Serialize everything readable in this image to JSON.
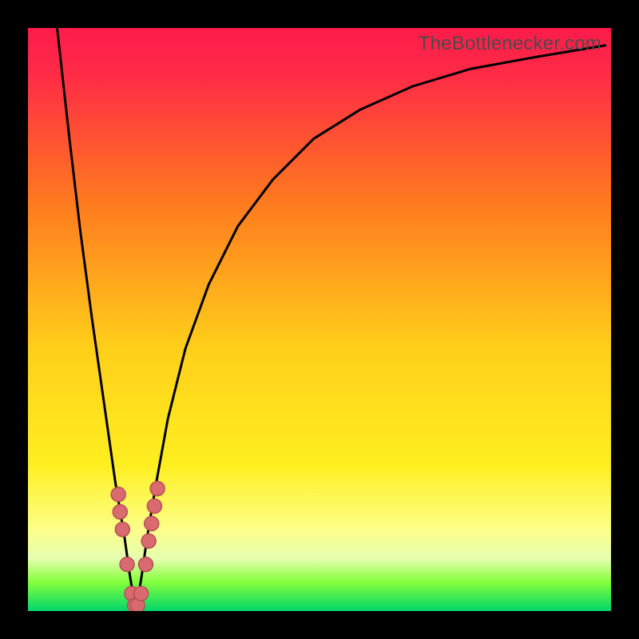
{
  "attribution": "TheBottlenecker.com",
  "colors": {
    "red_top": "#ff1b4b",
    "orange_mid": "#ff9a1f",
    "yellow": "#ffef20",
    "pale_yellow": "#fcff89",
    "lime": "#86ff3d",
    "green_bottom": "#00d66a",
    "curve": "#000000",
    "dot_fill": "#d96a6f",
    "dot_stroke": "#b54f55",
    "frame": "#000000",
    "attribution_text": "#4b4b4b"
  },
  "chart_data": {
    "type": "line",
    "title": "",
    "xlabel": "",
    "ylabel": "",
    "xlim": [
      0,
      100
    ],
    "ylim": [
      0,
      100
    ],
    "optimum_x": 18.5,
    "series": [
      {
        "name": "bottleneck_curve",
        "x": [
          5,
          7,
          9,
          11,
          13,
          15,
          16.5,
          17.5,
          18.5,
          19.5,
          20.5,
          22,
          24,
          27,
          31,
          36,
          42,
          49,
          57,
          66,
          76,
          87,
          99
        ],
        "values": [
          100,
          82,
          65,
          50,
          36,
          22,
          13,
          6,
          0,
          6,
          13,
          22,
          33,
          45,
          56,
          66,
          74,
          81,
          86,
          90,
          93,
          95,
          97
        ]
      }
    ],
    "highlight_points": {
      "name": "observed_points",
      "x": [
        15.5,
        15.8,
        16.2,
        17.0,
        17.8,
        18.3,
        18.8,
        19.4,
        20.2,
        20.7,
        21.2,
        21.7,
        22.2
      ],
      "values": [
        20,
        17,
        14,
        8,
        3,
        1,
        1,
        3,
        8,
        12,
        15,
        18,
        21
      ]
    },
    "background_meaning": "vertical gradient encodes bottleneck severity: green (near 0) = balanced, red (near 100) = severe bottleneck"
  }
}
